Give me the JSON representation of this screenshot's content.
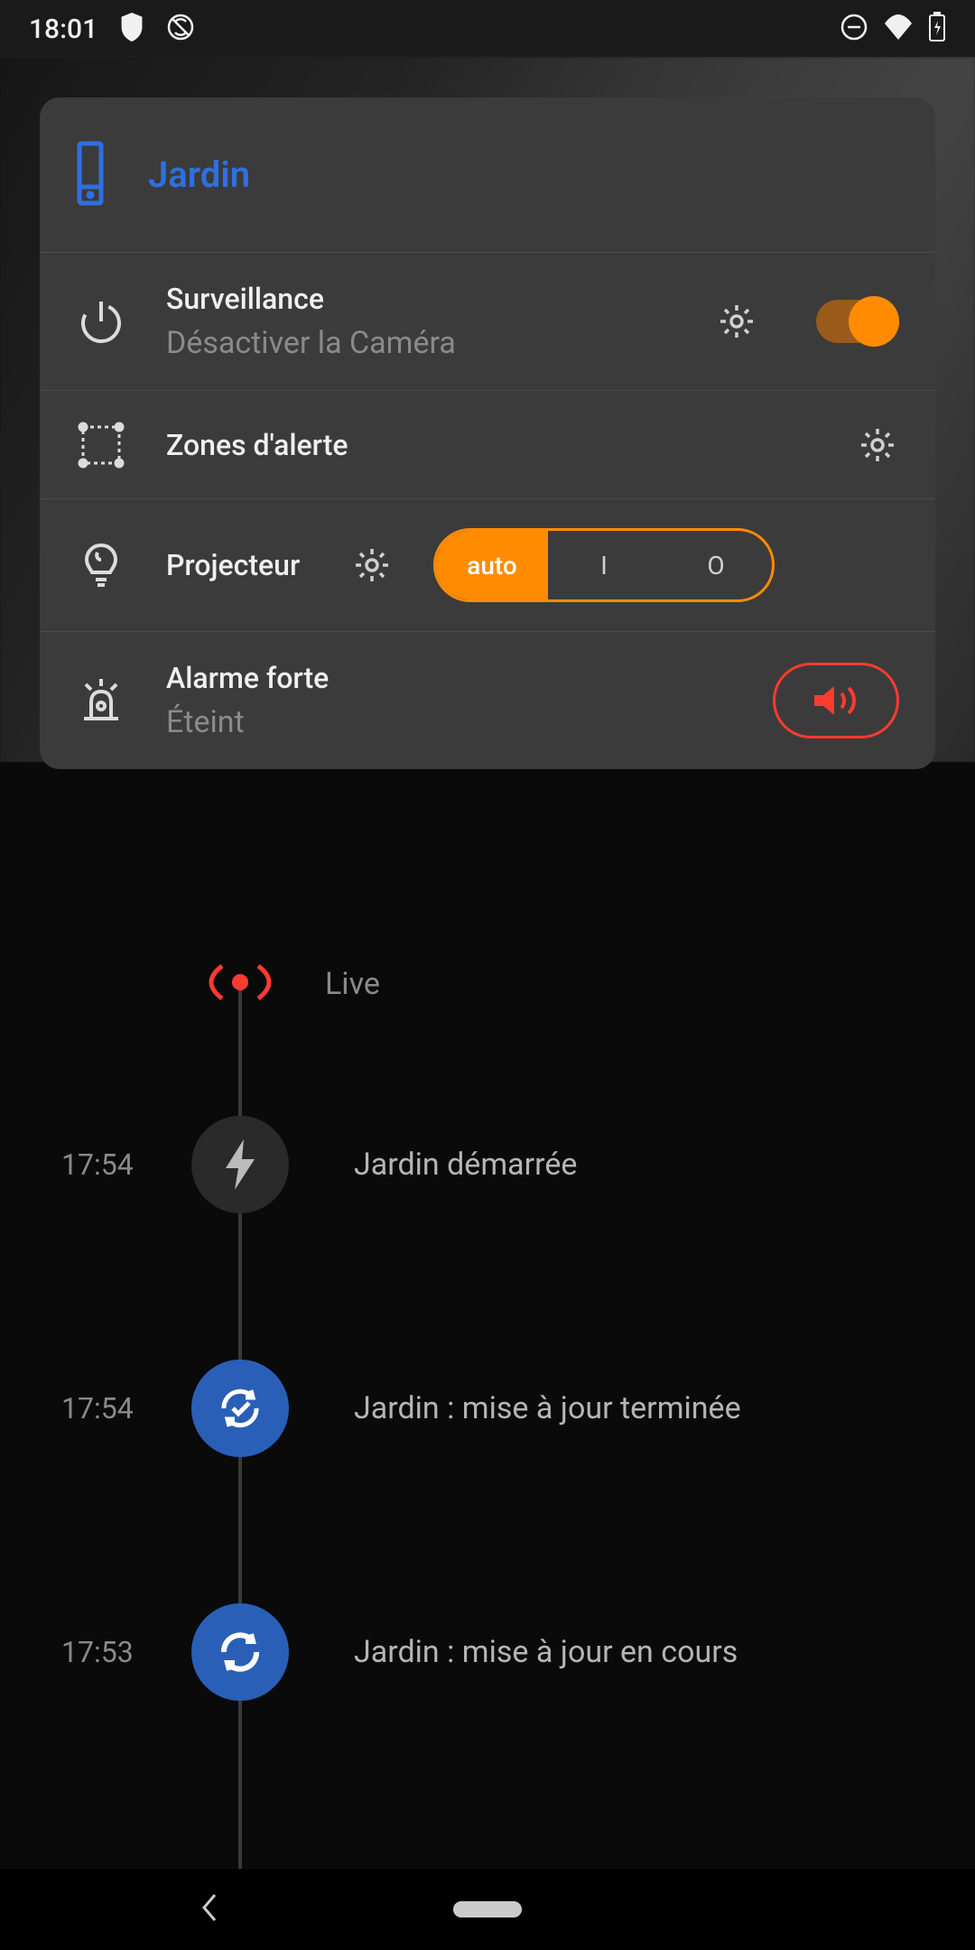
{
  "status": {
    "time": "18:01"
  },
  "panel": {
    "title": "Jardin",
    "surveillance": {
      "title": "Surveillance",
      "subtitle": "Désactiver la Caméra"
    },
    "zones": {
      "title": "Zones d'alerte"
    },
    "projector": {
      "title": "Projecteur",
      "options": {
        "auto": "auto",
        "on": "I",
        "off": "O"
      }
    },
    "alarm": {
      "title": "Alarme forte",
      "subtitle": "Éteint"
    }
  },
  "timeline": {
    "live_label": "Live",
    "events": [
      {
        "time": "17:54",
        "label": "Jardin démarrée",
        "icon": "bolt",
        "color": "dark"
      },
      {
        "time": "17:54",
        "label": "Jardin : mise à jour terminée",
        "icon": "sync-check",
        "color": "blue"
      },
      {
        "time": "17:53",
        "label": "Jardin : mise à jour en cours",
        "icon": "sync",
        "color": "blue"
      }
    ]
  }
}
